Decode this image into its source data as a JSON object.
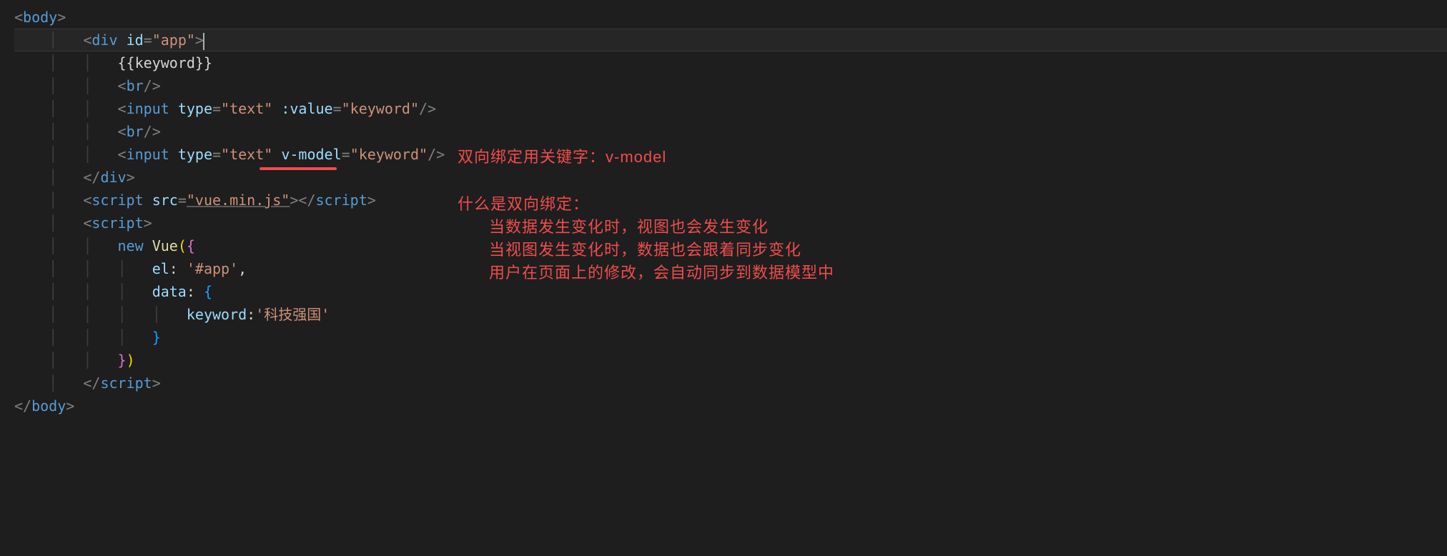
{
  "code": {
    "line1": {
      "tag_open": "<",
      "tag_name": "body",
      "tag_close": ">"
    },
    "line2": {
      "tag_open": "<",
      "tag_name": "div",
      "attr_name": "id",
      "eq": "=",
      "attr_value": "\"app\"",
      "tag_close": ">"
    },
    "line3": {
      "text": "{{keyword}}"
    },
    "line4": {
      "tag_open": "<",
      "tag_name": "br",
      "tag_close": "/>"
    },
    "line5": {
      "tag_open": "<",
      "tag_name": "input",
      "attr1_name": "type",
      "eq": "=",
      "attr1_value": "\"text\"",
      "attr2_name": ":value",
      "attr2_value": "\"keyword\"",
      "tag_close": "/>"
    },
    "line6": {
      "tag_open": "<",
      "tag_name": "br",
      "tag_close": "/>"
    },
    "line7": {
      "tag_open": "<",
      "tag_name": "input",
      "attr1_name": "type",
      "eq": "=",
      "attr1_value": "\"text\"",
      "attr2_name": "v-model",
      "attr2_value": "\"keyword\"",
      "tag_close": "/>"
    },
    "line8": {
      "tag_open": "</",
      "tag_name": "div",
      "tag_close": ">"
    },
    "line9": {
      "tag_open": "<",
      "tag_name": "script",
      "attr_name": "src",
      "eq": "=",
      "attr_value": "\"vue.min.js\"",
      "tag_close": ">",
      "close_tag_open": "</",
      "close_tag_name": "script",
      "close_tag_close": ">"
    },
    "line10": {
      "tag_open": "<",
      "tag_name": "script",
      "tag_close": ">"
    },
    "line11": {
      "kw": "new",
      "func": "Vue",
      "paren_open": "(",
      "brace_open": "{"
    },
    "line12": {
      "key": "el",
      "colon": ":",
      "value": "'#app'",
      "comma": ","
    },
    "line13": {
      "key": "data",
      "colon": ":",
      "brace_open": "{"
    },
    "line14": {
      "key": "keyword",
      "colon": ":",
      "value": "'科技强国'"
    },
    "line15": {
      "brace_close": "}"
    },
    "line16": {
      "brace_close": "}",
      "paren_close": ")"
    },
    "line17": {
      "tag_open": "</",
      "tag_name": "script",
      "tag_close": ">"
    },
    "line18": {
      "tag_open": "</",
      "tag_name": "body",
      "tag_close": ">"
    }
  },
  "annotations": {
    "a1": "双向绑定用关键字：v-model",
    "a2": "什么是双向绑定：",
    "a3": "当数据发生变化时，视图也会发生变化",
    "a4": "当视图发生变化时，数据也会跟着同步变化",
    "a5": "用户在页面上的修改，会自动同步到数据模型中"
  }
}
